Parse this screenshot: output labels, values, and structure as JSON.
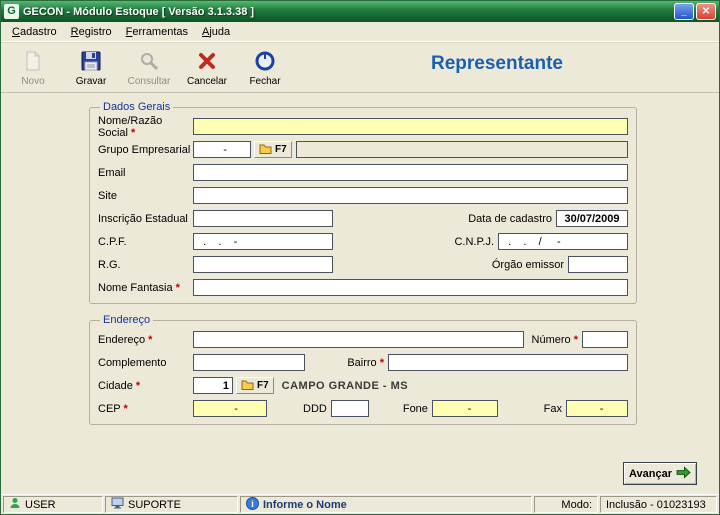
{
  "window": {
    "title": "GECON  -  Módulo Estoque    [ Versão 3.1.3.38 ]"
  },
  "menu": {
    "items": [
      "Cadastro",
      "Registro",
      "Ferramentas",
      "Ajuda"
    ]
  },
  "toolbar": {
    "buttons": [
      {
        "label": "Novo"
      },
      {
        "label": "Gravar"
      },
      {
        "label": "Consultar"
      },
      {
        "label": "Cancelar"
      },
      {
        "label": "Fechar"
      }
    ],
    "page_title": "Representante"
  },
  "common": {
    "f7": "F7",
    "required": "*"
  },
  "form": {
    "dados_gerais": {
      "legend": "Dados Gerais",
      "nome_label": "Nome/Razão Social",
      "grupo_label": "Grupo Empresarial",
      "grupo_value": "  -",
      "email_label": "Email",
      "site_label": "Site",
      "inscricao_label": "Inscrição Estadual",
      "data_cadastro_label": "Data de cadastro",
      "data_cadastro_value": "30/07/2009",
      "cpf_label": "C.P.F.",
      "cpf_mask": "  .    .    -",
      "cnpj_label": "C.N.P.J.",
      "cnpj_mask": "  .    .    /     -",
      "rg_label": "R.G.",
      "orgao_label": "Órgão emissor",
      "fantasia_label": "Nome Fantasia"
    },
    "endereco": {
      "legend": "Endereço",
      "endereco_label": "Endereço",
      "numero_label": "Número",
      "complemento_label": "Complemento",
      "bairro_label": "Bairro",
      "cidade_label": "Cidade",
      "cidade_value": "1",
      "cidade_nome": "CAMPO GRANDE - MS",
      "cep_label": "CEP",
      "cep_mask": "    -",
      "ddd_label": "DDD",
      "fone_label": "Fone",
      "fone_mask": "   -",
      "fax_label": "Fax",
      "fax_mask": "   -"
    }
  },
  "footer": {
    "avancar_label": "Avançar"
  },
  "statusbar": {
    "user": "USER",
    "suporte": "SUPORTE",
    "message": "Informe o Nome",
    "modo_label": "Modo:",
    "modo_value": "Inclusão - 01023193"
  },
  "window_controls": {
    "minimize": "_",
    "close": "✕"
  }
}
